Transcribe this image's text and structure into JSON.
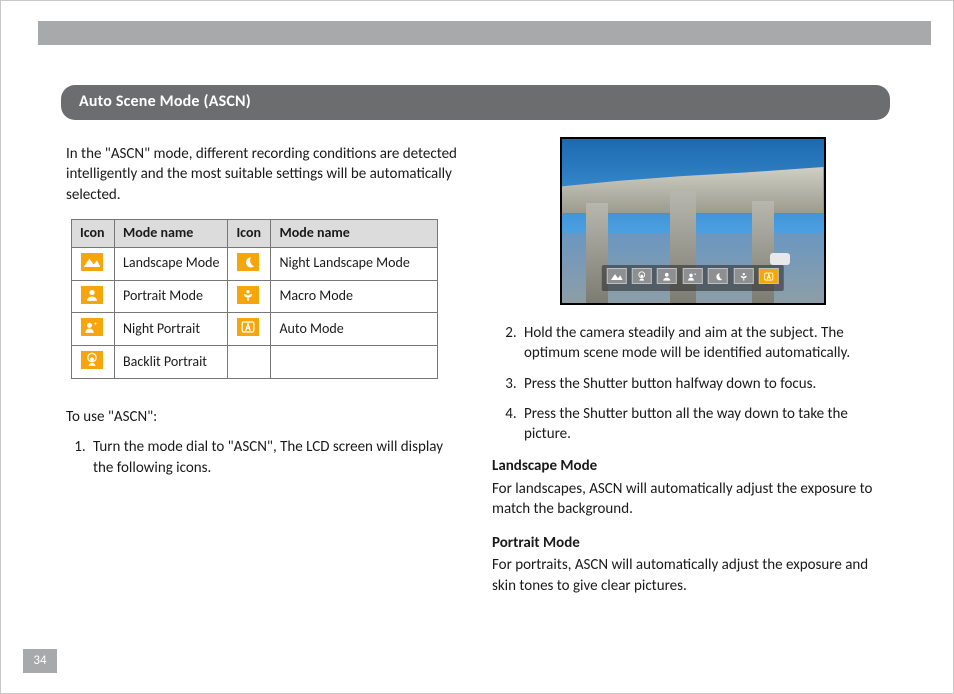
{
  "title": "Auto Scene Mode (ASCN)",
  "intro": "In the \"ASCN\" mode, different recording conditions are detected intelligently and the most suitable settings will be automatically selected.",
  "table": {
    "headers": {
      "icon": "Icon",
      "name": "Mode name"
    },
    "rows": [
      {
        "iconL": "landscape-icon",
        "nameL": "Landscape Mode",
        "iconR": "moon-icon",
        "nameR": "Night Landscape Mode"
      },
      {
        "iconL": "portrait-icon",
        "nameL": "Portrait Mode",
        "iconR": "macro-icon",
        "nameR": "Macro Mode"
      },
      {
        "iconL": "night-portrait-icon",
        "nameL": "Night Portrait",
        "iconR": "auto-a-icon",
        "nameR": "Auto Mode"
      },
      {
        "iconL": "backlit-portrait-icon",
        "nameL": "Backlit Portrait",
        "iconR": "",
        "nameR": ""
      }
    ]
  },
  "to_use": "To use \"ASCN\":",
  "steps_left": {
    "1": "Turn the mode dial to \"ASCN\", The LCD screen will display the following icons."
  },
  "steps_right": {
    "2": "Hold the camera steadily and aim at the subject. The optimum scene mode will be identified automatically.",
    "3": "Press the Shutter button halfway down to focus.",
    "4": "Press the Shutter button all the way down to take the picture."
  },
  "strip_icons": [
    "landscape-icon",
    "backlit-portrait-icon",
    "portrait-icon",
    "night-portrait-icon",
    "moon-icon",
    "macro-icon",
    "auto-a-icon"
  ],
  "strip_highlight_index": 6,
  "sections": {
    "landscape": {
      "title": "Landscape Mode",
      "text": "For landscapes, ASCN will automatically adjust the exposure to match the background."
    },
    "portrait": {
      "title": "Portrait Mode",
      "text": "For portraits, ASCN will automatically adjust the exposure and skin tones to give clear pictures."
    }
  },
  "page_number": "34",
  "colors": {
    "accent": "#f6a60a",
    "bar": "#a8a9aa",
    "title_bg": "#6c6d6f"
  }
}
